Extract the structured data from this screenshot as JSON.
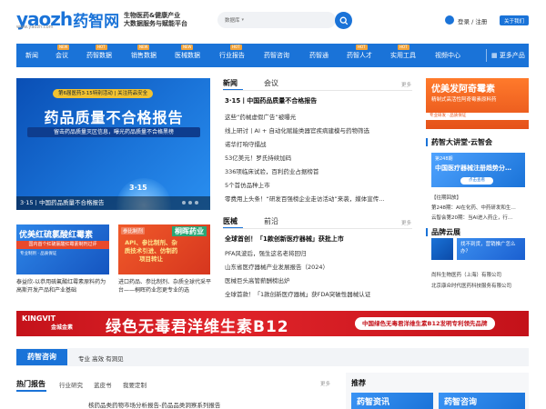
{
  "header": {
    "logo_text": "yaozh",
    "logo_cn": "药智网",
    "logo_url": "www.yaozh.com",
    "slogan_line1": "生物医药&健康产业",
    "slogan_line2": "大数据服务与赋能平台",
    "search_scope": "数据库",
    "login_label": "登录 / 注册",
    "follow_label": "关于我们"
  },
  "nav": {
    "items": [
      {
        "label": "新闻"
      },
      {
        "label": "会议",
        "tag": "NEW"
      },
      {
        "label": "药智数据",
        "tag": "HOT"
      },
      {
        "label": "销售数据",
        "tag": "NEW"
      },
      {
        "label": "医械数据",
        "tag": "NEW"
      },
      {
        "label": "行业报告",
        "tag": "HOT"
      },
      {
        "label": "药智咨询"
      },
      {
        "label": "药智通"
      },
      {
        "label": "药智人才",
        "tag": "HOT"
      },
      {
        "label": "实用工具",
        "tag": "HOT"
      },
      {
        "label": "视频中心"
      },
      {
        "label": "更多产品"
      }
    ]
  },
  "banner": {
    "tag": "第6届医药3·15特别活动 | 关注药品安全",
    "title": "药品质量不合格报告",
    "sub": "留击药品质量灭区信息，曝光药品质量不合格黑榜",
    "badge": "3·15",
    "caption": "3·15丨中国药品质量不合格报告"
  },
  "card1": {
    "title": "优美红硫氯酸红霉素",
    "band": "国内首个红硫氯酸红霉素制剂过评",
    "small": "专业制剂 · 品质保证",
    "caption": "泰益欣-以恭用硫氟酸红霉素原料药为高斯开发产品和产业基础"
  },
  "card2": {
    "tag": "参比制剂",
    "brand": "桐晖药业",
    "text": "API、参比制剂、杂质技术引进、仿制药项目转让",
    "caption": "进口药品、参比制剂、杂质全球代采平台——桐晖药业您更专业的选"
  },
  "news_block1": {
    "tabs": [
      "新闻",
      "会议"
    ],
    "more": "更多",
    "items": [
      "3·15丨中国药品质量不合格报告",
      "这些“药械虚假广告”被曝光",
      "线上研讨丨AI + 自动化赋能类器官疾病建模与药物筛选",
      "诺华打响守擂战",
      "53亿美元！罗氏持续加码",
      "336项临床试验，百利药业占据榜首",
      "5个首仿品种上市",
      "零费用上头条！“研发百强榜企业走访活动”来袭，媒体宣传…"
    ]
  },
  "news_block2": {
    "tabs": [
      "医械",
      "前沿"
    ],
    "more": "更多",
    "items": [
      "全球首创！「1款创新医疗器械」获批上市",
      "PFA风波后，强生这名老将回归",
      "山东省医疗器械产业发展报告（2024）",
      "医械巨头高管薪酬榜出炉",
      "全球首款！「1款创新医疗器械」获FDA突破性器械认证"
    ]
  },
  "right": {
    "banner_title": "优美发阿奇霉素",
    "banner_sub": "精制式高活性阿奇霉素原料药",
    "banner_band": "专业研发 · 品质保证",
    "lecture_title": "药智大讲堂·云智会",
    "card_small": "第248期",
    "card_title": "中国医疗器械注册趋势分…",
    "card_btn": "点击查看",
    "topic_label": "【往期回放】",
    "topic_line1": "第248期：AI在化药、中药研发和生…",
    "topic_line2": "云智会第20期：当AI进入药企，行…",
    "brand_title": "品牌云展",
    "ad_text": "找不到货，营销推广怎么办？",
    "brand_line1": "尚科生物医药（上海）有限公司",
    "brand_line2": "北京康众时代医药科技服务有限公司"
  },
  "wide_banner": {
    "logo": "KINGVIT",
    "logo_cn": "金城金素",
    "big": "绿色无毒君洋维生素B12",
    "pill": "中国绿色无毒君洋维生素B12发明专利领先品牌"
  },
  "consult": {
    "title": "药智咨询",
    "tagline": "专业 高效 有洞见"
  },
  "hot": {
    "title": "热门报告",
    "tabs": [
      "行业研究",
      "蓝皮书",
      "我要定制"
    ],
    "more": "更多",
    "item": "核药品类药物市场分析报告-药品品类洞察系列报告"
  },
  "recommend": {
    "title": "推荐",
    "img1": "药智资讯",
    "img2": "药智咨询"
  },
  "colors": {
    "brand": "#1a73d8",
    "nav_tag": "#f2a33a",
    "wide_banner": "#c4121a"
  }
}
